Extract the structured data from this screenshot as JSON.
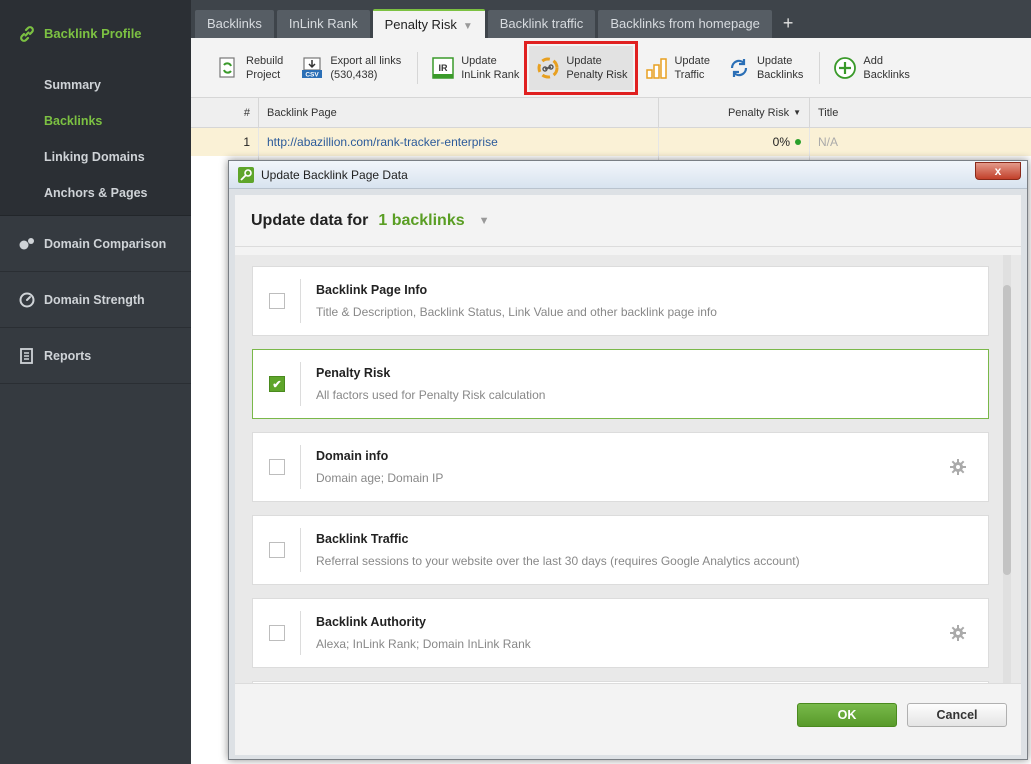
{
  "sidebar": {
    "profile_label": "Backlink Profile",
    "sub_items": [
      "Summary",
      "Backlinks",
      "Linking Domains",
      "Anchors & Pages"
    ],
    "active_sub": "Backlinks",
    "items": [
      "Domain Comparison",
      "Domain Strength",
      "Reports"
    ]
  },
  "tabs": [
    "Backlinks",
    "InLink Rank",
    "Penalty Risk",
    "Backlink traffic",
    "Backlinks from homepage"
  ],
  "active_tab": "Penalty Risk",
  "toolbar": {
    "rebuild": [
      "Rebuild",
      "Project"
    ],
    "export": [
      "Export all links",
      "(530,438)"
    ],
    "update_inlink": [
      "Update",
      "InLink Rank"
    ],
    "update_penalty": [
      "Update",
      "Penalty Risk"
    ],
    "update_traffic": [
      "Update",
      "Traffic"
    ],
    "update_backlinks": [
      "Update",
      "Backlinks"
    ],
    "add_backlinks": [
      "Add",
      "Backlinks"
    ]
  },
  "table": {
    "headers": [
      "#",
      "Backlink Page",
      "Penalty Risk",
      "Title"
    ],
    "row1": {
      "num": "1",
      "url": "http://abazillion.com/rank-tracker-enterprise",
      "risk": "0%",
      "title": "N/A"
    }
  },
  "dialog": {
    "title": "Update Backlink Page Data",
    "close": "x",
    "heading": "Update data for",
    "count": "1 backlinks",
    "options": [
      {
        "title": "Backlink Page Info",
        "desc": "Title & Description, Backlink Status, Link Value and other backlink page info",
        "checked": false
      },
      {
        "title": "Penalty Risk",
        "desc": "All factors used for Penalty Risk calculation",
        "checked": true
      },
      {
        "title": "Domain info",
        "desc": "Domain age; Domain IP",
        "checked": false
      },
      {
        "title": "Backlink Traffic",
        "desc": "Referral sessions to your website over the last 30 days (requires Google Analytics account)",
        "checked": false
      },
      {
        "title": "Backlink Authority",
        "desc": "Alexa; InLink Rank; Domain InLink Rank",
        "checked": false
      }
    ],
    "ok": "OK",
    "cancel": "Cancel"
  },
  "colors": {
    "accent": "#7cc142",
    "highlight": "#e02020",
    "sidebar": "#353a40"
  }
}
